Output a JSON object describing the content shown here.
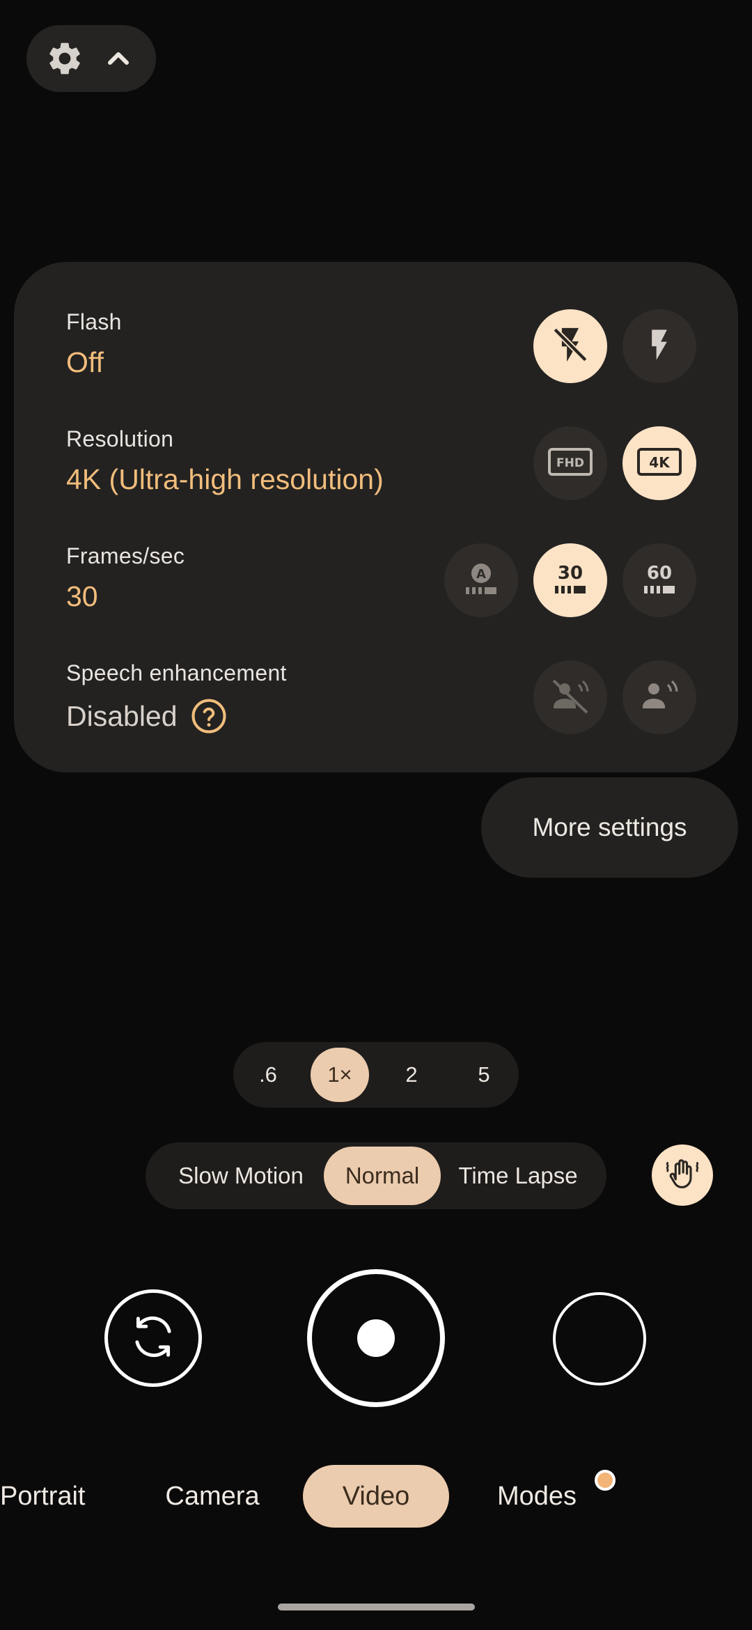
{
  "top_bar": {
    "settings_icon": "gear-icon",
    "collapse_icon": "chevron-up-icon"
  },
  "settings_panel": {
    "flash": {
      "label": "Flash",
      "value": "Off",
      "options": [
        {
          "icon": "flash-off-icon",
          "selected": true
        },
        {
          "icon": "flash-on-icon",
          "selected": false
        }
      ]
    },
    "resolution": {
      "label": "Resolution",
      "value": "4K (Ultra-high resolution)",
      "options": [
        {
          "icon": "fhd-icon",
          "text": "FHD",
          "selected": false
        },
        {
          "icon": "4k-icon",
          "text": "4K",
          "selected": true
        }
      ]
    },
    "fps": {
      "label": "Frames/sec",
      "value": "30",
      "options": [
        {
          "icon": "fps-auto-icon",
          "text": "A",
          "selected": false
        },
        {
          "icon": "fps-30-icon",
          "text": "30",
          "selected": true
        },
        {
          "icon": "fps-60-icon",
          "text": "60",
          "selected": false
        }
      ]
    },
    "speech": {
      "label": "Speech enhancement",
      "value": "Disabled",
      "help_icon": "help-circle-icon",
      "options": [
        {
          "icon": "speech-off-icon",
          "selected": false
        },
        {
          "icon": "speech-on-icon",
          "selected": false
        }
      ]
    }
  },
  "more_settings": "More settings",
  "zoom": {
    "levels": [
      ".6",
      "1×",
      "2",
      "5"
    ],
    "selected": "1×"
  },
  "video_modes": {
    "items": [
      "Slow Motion",
      "Normal",
      "Time Lapse"
    ],
    "selected": "Normal"
  },
  "stabilization_icon": "hand-stabilization-icon",
  "mode_tabs": {
    "items": [
      "Portrait",
      "Camera",
      "Video",
      "Modes"
    ],
    "selected": "Video"
  },
  "colors": {
    "accent": "#f2bd7c",
    "selected_chip": "#ecccae",
    "selected_option": "#fde3c6",
    "panel": "#232221"
  }
}
